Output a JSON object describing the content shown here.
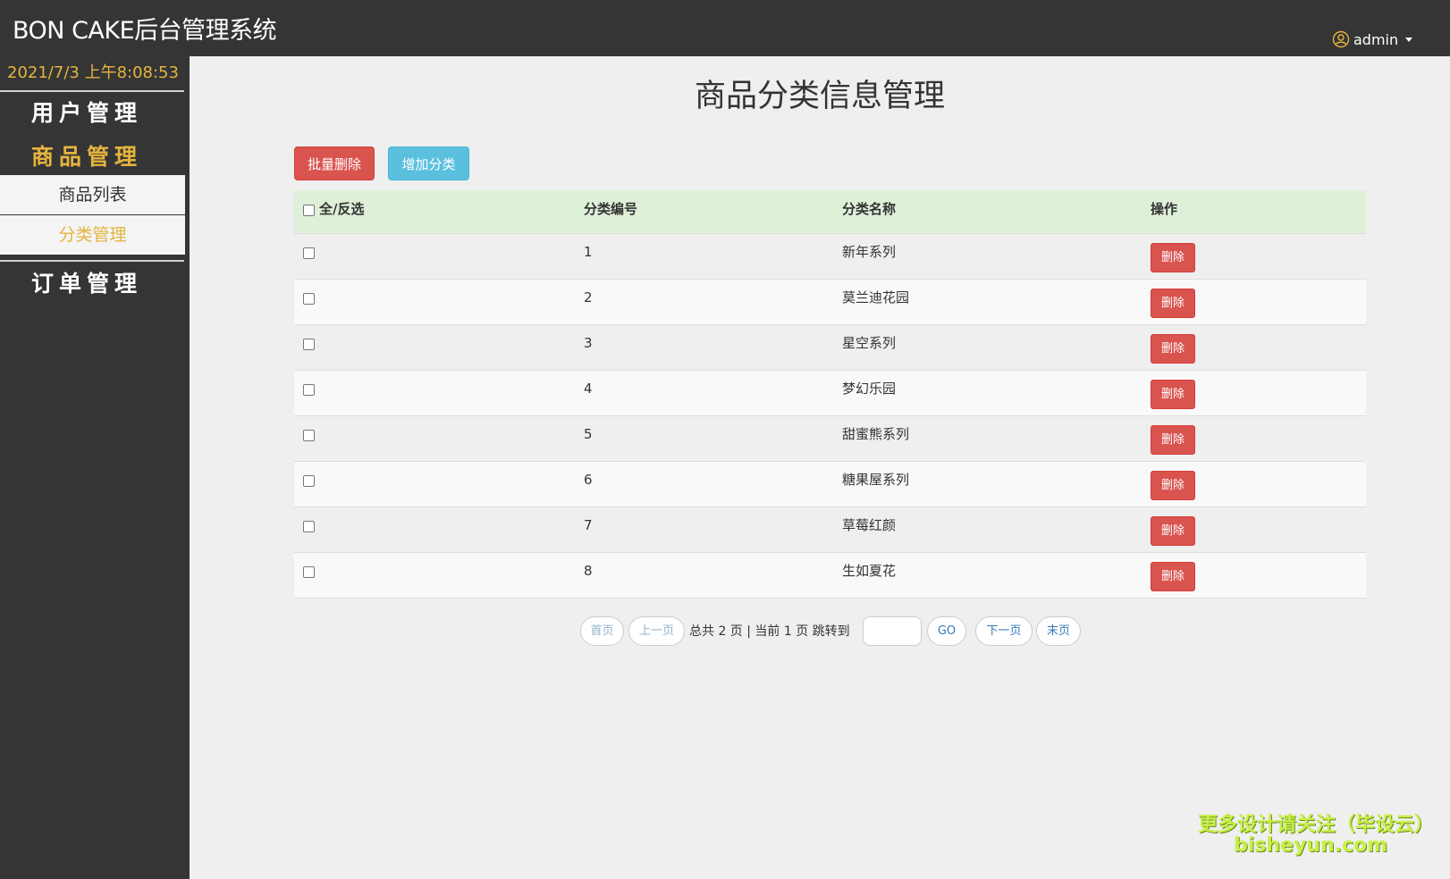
{
  "header": {
    "brand": "BON CAKE后台管理系统",
    "user_label": "admin",
    "user_icon": "user-circle-icon"
  },
  "sidebar": {
    "clock": "2021/7/3 上午8:08:53",
    "menu": [
      {
        "label": "用户管理"
      },
      {
        "label": "商品管理",
        "sub": [
          {
            "label": "商品列表"
          },
          {
            "label": "分类管理"
          }
        ]
      },
      {
        "label": "订单管理"
      }
    ]
  },
  "main": {
    "title": "商品分类信息管理",
    "batch_delete_label": "批量删除",
    "add_category_label": "增加分类",
    "table": {
      "headers": [
        "全/反选",
        "分类编号",
        "分类名称",
        "操作"
      ],
      "rows": [
        {
          "id": "1",
          "name": "新年系列",
          "action": "删除"
        },
        {
          "id": "2",
          "name": "莫兰迪花园",
          "action": "删除"
        },
        {
          "id": "3",
          "name": "星空系列",
          "action": "删除"
        },
        {
          "id": "4",
          "name": "梦幻乐园",
          "action": "删除"
        },
        {
          "id": "5",
          "name": "甜蜜熊系列",
          "action": "删除"
        },
        {
          "id": "6",
          "name": "糖果屋系列",
          "action": "删除"
        },
        {
          "id": "7",
          "name": "草莓红颜",
          "action": "删除"
        },
        {
          "id": "8",
          "name": "生如夏花",
          "action": "删除"
        }
      ]
    },
    "pagination": {
      "first": "首页",
      "prev": "上一页",
      "info": "总共 2 页 | 当前 1 页 跳转到",
      "go": "GO",
      "next": "下一页",
      "last": "末页",
      "jump_value": ""
    }
  },
  "watermark": {
    "line1": "更多设计请关注（毕设云）",
    "line2": "bisheyun.com"
  },
  "colors": {
    "topbar": "#353535",
    "accent": "#e4b43e",
    "danger": "#d9534f",
    "info": "#5bc0de",
    "table_header": "#dff0d8"
  }
}
